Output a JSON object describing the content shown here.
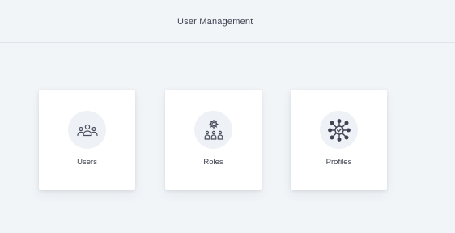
{
  "header": {
    "title": "User Management"
  },
  "cards": [
    {
      "label": "Users",
      "icon": "users-group-icon"
    },
    {
      "label": "Roles",
      "icon": "roles-gear-people-icon"
    },
    {
      "label": "Profiles",
      "icon": "profiles-network-icon"
    }
  ],
  "colors": {
    "background": "#f2f5f8",
    "card": "#ffffff",
    "icon_circle": "#eef1f5",
    "icon_stroke": "#4a4f5e",
    "text": "#3e4352"
  }
}
